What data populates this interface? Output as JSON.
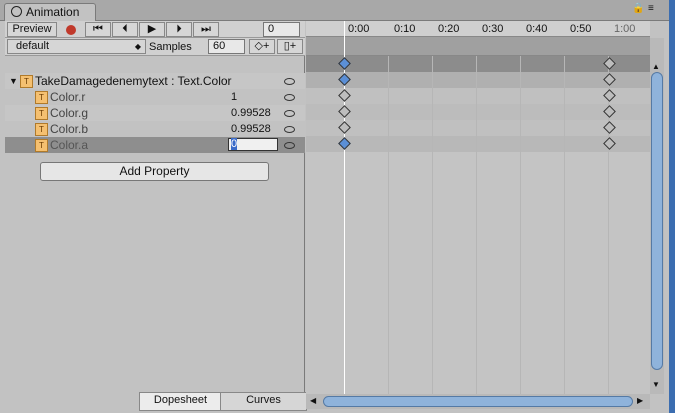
{
  "window": {
    "tab_title": "Animation",
    "lock_icon": "lock-icon",
    "menu_icon": "menu-icon"
  },
  "toolbar": {
    "preview_label": "Preview",
    "record_icon": "record-icon",
    "first_key_icon": "first-key-icon",
    "prev_key_icon": "prev-key-icon",
    "play_icon": "play-icon",
    "next_key_icon": "next-key-icon",
    "last_key_icon": "last-key-icon",
    "frame_value": "0",
    "clip_name": "default",
    "samples_label": "Samples",
    "samples_value": "60",
    "add_keyframe_icon": "add-keyframe-icon",
    "add_event_icon": "add-event-icon"
  },
  "properties": {
    "group": {
      "name": "TakeDamagedenemytext : Text.Color"
    },
    "items": [
      {
        "name": "Color.r",
        "value": "1"
      },
      {
        "name": "Color.g",
        "value": "0.99528"
      },
      {
        "name": "Color.b",
        "value": "0.99528"
      },
      {
        "name": "Color.a",
        "value": "0"
      }
    ],
    "add_property_label": "Add Property"
  },
  "timeline": {
    "ticks": [
      "0:00",
      "0:10",
      "0:20",
      "0:30",
      "0:40",
      "0:50",
      "1:00"
    ],
    "keyframes_at": [
      "0:00",
      "0:50"
    ]
  },
  "bottom_tabs": {
    "dopesheet": "Dopesheet",
    "curves": "Curves"
  },
  "colors": {
    "selected_key": "#5b8fd6",
    "unselected_key": "#bdbdbd",
    "record": "#c0392b",
    "scroll_thumb": "#8fb3db"
  }
}
